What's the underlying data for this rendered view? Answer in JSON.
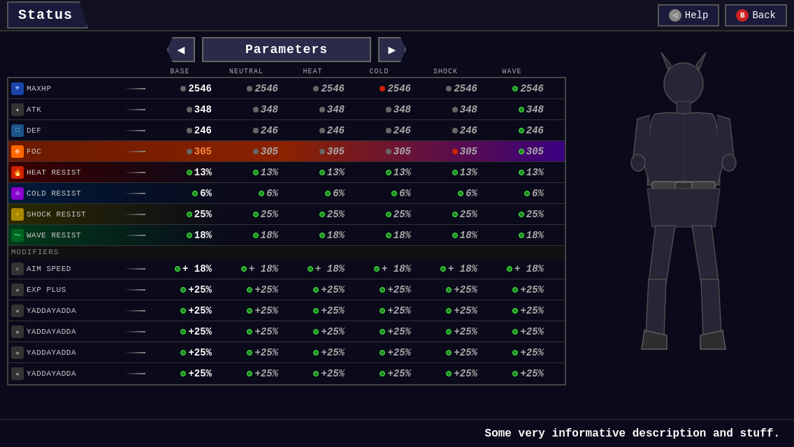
{
  "topBar": {
    "title": "Status",
    "helpLabel": "Help",
    "backLabel": "Back",
    "helpIcon": "◁",
    "backIconLabel": "B"
  },
  "params": {
    "title": "Parameters",
    "prevArrow": "◀",
    "nextArrow": "▶"
  },
  "columns": {
    "label": "",
    "headers": [
      "BASE",
      "NEUTRAL",
      "HEAT",
      "COLD",
      "SHOCK",
      "WAVE"
    ]
  },
  "stats": [
    {
      "id": "maxhp",
      "icon": "♥",
      "iconClass": "icon-hp",
      "label": "MAXHP",
      "values": [
        "2546",
        "2546",
        "2546",
        "2546",
        "2546",
        "2546"
      ],
      "dots": [
        "gray",
        "gray",
        "gray",
        "red",
        "gray",
        "green"
      ],
      "rowClass": ""
    },
    {
      "id": "atk",
      "icon": "✦",
      "iconClass": "icon-atk",
      "label": "ATK",
      "values": [
        "348",
        "348",
        "348",
        "348",
        "348",
        "348"
      ],
      "dots": [
        "gray",
        "gray",
        "gray",
        "gray",
        "gray",
        "green"
      ],
      "rowClass": ""
    },
    {
      "id": "def",
      "icon": "□",
      "iconClass": "icon-def",
      "label": "DEF",
      "values": [
        "246",
        "246",
        "246",
        "246",
        "246",
        "246"
      ],
      "dots": [
        "gray",
        "gray",
        "gray",
        "gray",
        "gray",
        "green"
      ],
      "rowClass": ""
    },
    {
      "id": "foc",
      "icon": "⊕",
      "iconClass": "icon-foc",
      "label": "FOC",
      "values": [
        "305",
        "305",
        "305",
        "305",
        "305",
        "305"
      ],
      "dots": [
        "gray",
        "gray",
        "gray",
        "gray",
        "red",
        "green"
      ],
      "rowClass": "foc-row"
    },
    {
      "id": "heat-resist",
      "icon": "🔥",
      "iconClass": "icon-heat",
      "label": "HEAT RESIST",
      "values": [
        "13%",
        "13%",
        "13%",
        "13%",
        "13%",
        "13%"
      ],
      "dots": [
        "green",
        "green",
        "green",
        "green",
        "green",
        "green"
      ],
      "rowClass": "heat-row"
    },
    {
      "id": "cold-resist",
      "icon": "❄",
      "iconClass": "icon-cold",
      "label": "COLD RESIST",
      "values": [
        "6%",
        "6%",
        "6%",
        "6%",
        "6%",
        "6%"
      ],
      "dots": [
        "green",
        "green",
        "green",
        "green",
        "green",
        "green"
      ],
      "rowClass": "cold-row"
    },
    {
      "id": "shock-resist",
      "icon": "⚡",
      "iconClass": "icon-shock",
      "label": "SHOCK RESIST",
      "values": [
        "25%",
        "25%",
        "25%",
        "25%",
        "25%",
        "25%"
      ],
      "dots": [
        "green",
        "green",
        "green",
        "green",
        "green",
        "green"
      ],
      "rowClass": "shock-row"
    },
    {
      "id": "wave-resist",
      "icon": "〜",
      "iconClass": "icon-wave",
      "label": "WAVE RESIST",
      "values": [
        "18%",
        "18%",
        "18%",
        "18%",
        "18%",
        "18%"
      ],
      "dots": [
        "green",
        "green",
        "green",
        "green",
        "green",
        "green"
      ],
      "rowClass": "wave-row"
    }
  ],
  "modifiersLabel": "MODIFIERS",
  "modifiers": [
    {
      "id": "aim-speed",
      "icon": "✛",
      "iconClass": "icon-mod",
      "label": "AIM SPEED",
      "values": [
        "+ 18%",
        "+ 18%",
        "+ 18%",
        "+ 18%",
        "+ 18%",
        "+ 18%"
      ],
      "dots": [
        "green",
        "green",
        "green",
        "green",
        "green",
        "green"
      ]
    },
    {
      "id": "exp-plus",
      "icon": "★",
      "iconClass": "icon-mod",
      "label": "EXP PLUS",
      "values": [
        "+25%",
        "+25%",
        "+25%",
        "+25%",
        "+25%",
        "+25%"
      ],
      "dots": [
        "green",
        "green",
        "green",
        "green",
        "green",
        "green"
      ]
    },
    {
      "id": "yadda1",
      "icon": "★",
      "iconClass": "icon-mod",
      "label": "YADDAYADDA",
      "values": [
        "+25%",
        "+25%",
        "+25%",
        "+25%",
        "+25%",
        "+25%"
      ],
      "dots": [
        "green",
        "green",
        "green",
        "green",
        "green",
        "green"
      ]
    },
    {
      "id": "yadda2",
      "icon": "★",
      "iconClass": "icon-mod",
      "label": "YADDAYADDA",
      "values": [
        "+25%",
        "+25%",
        "+25%",
        "+25%",
        "+25%",
        "+25%"
      ],
      "dots": [
        "green",
        "green",
        "green",
        "green",
        "green",
        "green"
      ]
    },
    {
      "id": "yadda3",
      "icon": "★",
      "iconClass": "icon-mod",
      "label": "YADDAYADDA",
      "values": [
        "+25%",
        "+25%",
        "+25%",
        "+25%",
        "+25%",
        "+25%"
      ],
      "dots": [
        "green",
        "green",
        "green",
        "green",
        "green",
        "green"
      ]
    },
    {
      "id": "yadda4",
      "icon": "★",
      "iconClass": "icon-mod",
      "label": "YADDAYADDA",
      "values": [
        "+25%",
        "+25%",
        "+25%",
        "+25%",
        "+25%",
        "+25%"
      ],
      "dots": [
        "green",
        "green",
        "green",
        "green",
        "green",
        "green"
      ]
    }
  ],
  "description": "Some very informative description and stuff.",
  "colors": {
    "accent": "#ff8844",
    "bg": "#0a0a1a",
    "panel": "#111122"
  }
}
